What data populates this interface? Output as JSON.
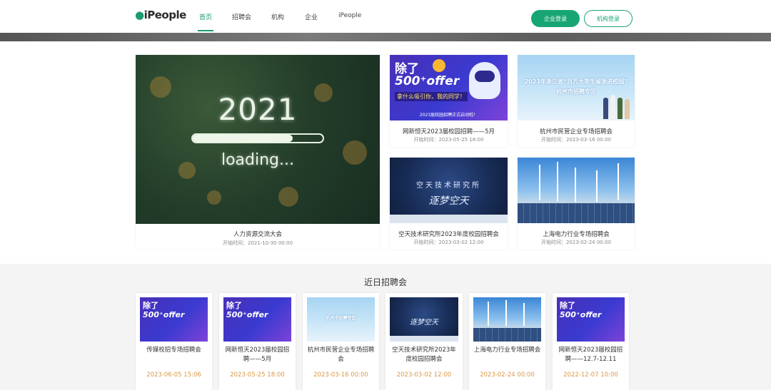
{
  "header": {
    "logo": "iPeople",
    "nav": [
      "首页",
      "招聘会",
      "机构",
      "企业",
      "iPeople"
    ],
    "btn_company_login": "企业登录",
    "btn_org_login": "机构登录"
  },
  "featured": {
    "main": {
      "year": "2021",
      "loading_text": "loading...",
      "loading_progress": 0.77,
      "title": "人力资源交流大会",
      "time": "开始时间：2021-10-30 00:00"
    },
    "cards": [
      {
        "title": "网新恒天2023届校园招聘——5月",
        "time": "开始时间：2023-05-25 18:00"
      },
      {
        "title": "杭州市民营企业专场招聘会",
        "time": "开始时间：2023-03-16 00:00"
      },
      {
        "title": "空天技术研究所2023年度校园招聘会",
        "time": "开始时间：2023-03-02 12:00"
      },
      {
        "title": "上海电力行业专场招聘会",
        "time": "开始时间：2023-02-24 00:00"
      }
    ]
  },
  "poster_offer": {
    "t1": "除了",
    "t2": "500⁺offer",
    "t3": "拿什么吸引你，我的同学！",
    "t4": "2023届校园招聘正式启动啦！"
  },
  "poster_hz": {
    "t1": "2023年浙江省“百万大学生留浙进校园”",
    "t2": "杭州市招聘专区"
  },
  "poster_space": {
    "t1": "空天技术研究所",
    "t2": "逐梦空天"
  },
  "recent": {
    "section_title": "近日招聘会",
    "items": [
      {
        "title": "传媒校招专场招聘会",
        "time": "2023-06-05 15:06"
      },
      {
        "title": "网新恒天2023届校园招聘——5月",
        "time": "2023-05-25 18:00"
      },
      {
        "title": "杭州市民营企业专场招聘会",
        "time": "2023-03-16 00:00"
      },
      {
        "title": "空天技术研究所2023年度校园招聘会",
        "time": "2023-03-02 12:00"
      },
      {
        "title": "上海电力行业专场招聘会",
        "time": "2023-02-24 00:00"
      },
      {
        "title": "网新恒天2023届校园招聘——12.7-12.11",
        "time": "2022-12-07 10:00"
      }
    ]
  }
}
